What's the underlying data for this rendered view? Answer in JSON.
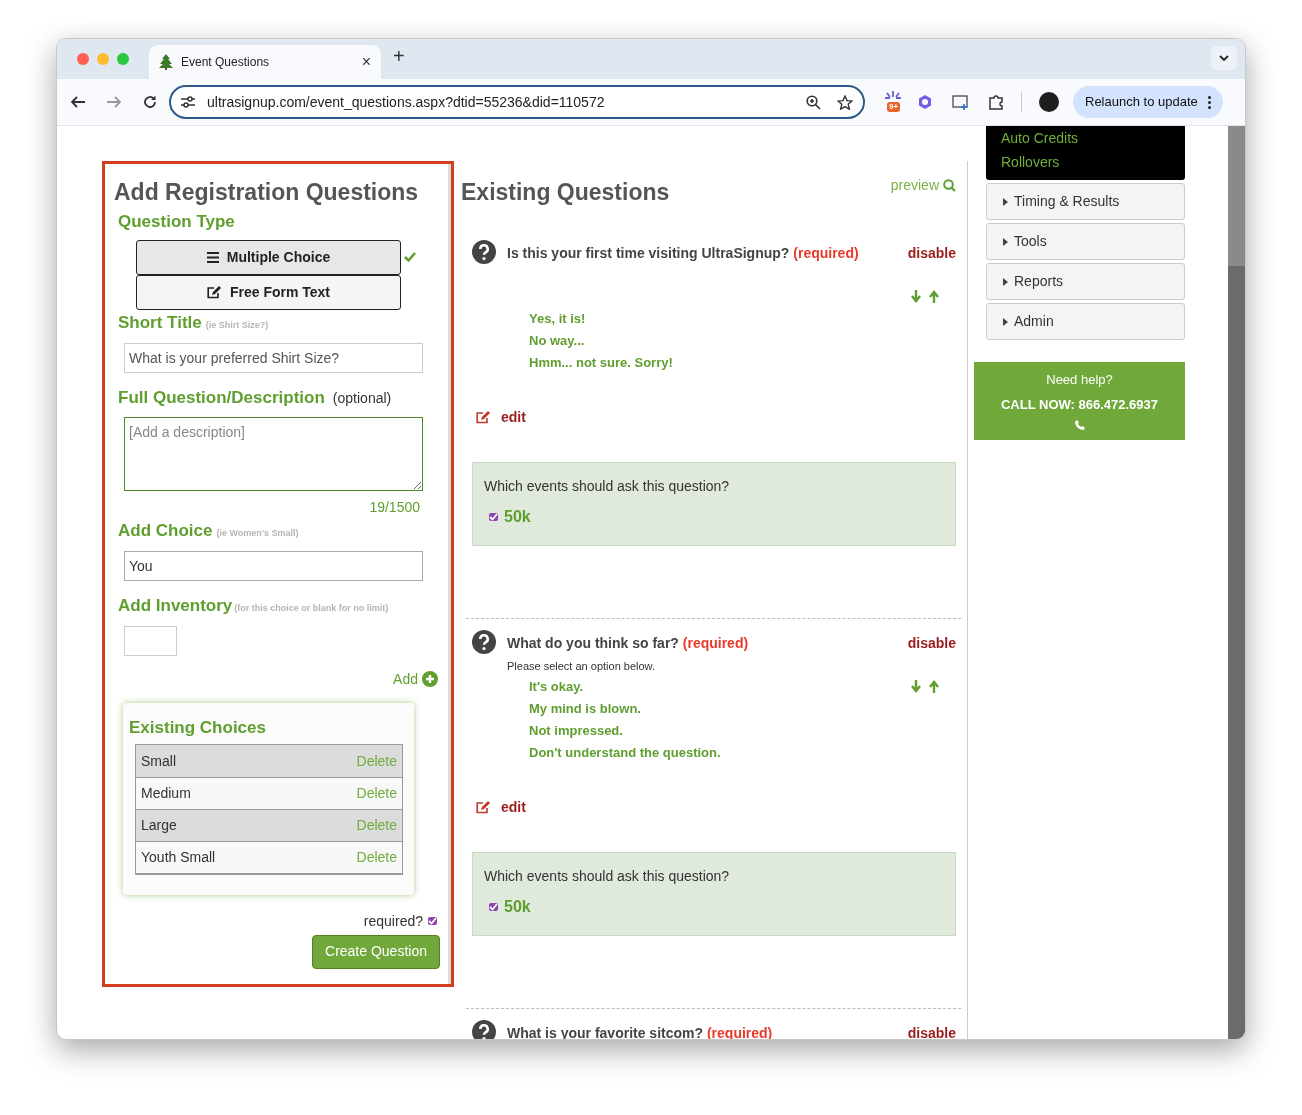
{
  "browser": {
    "tab_title": "Event Questions",
    "tab_close": "×",
    "new_tab": "+",
    "url": "ultrasignup.com/event_questions.aspx?dtid=55236&did=110572",
    "extension_badge": "9+",
    "relaunch_button": "Relaunch to update"
  },
  "add_panel": {
    "title": "Add Registration Questions",
    "question_type_label": "Question Type",
    "type_buttons": [
      {
        "label": "Multiple Choice",
        "kind": "list",
        "selected": true
      },
      {
        "label": "Free Form Text",
        "kind": "edit",
        "selected": false
      }
    ],
    "short_title": {
      "label": "Short Title",
      "hint": "(ie Shirt Size?)",
      "value": "What is your preferred Shirt Size?"
    },
    "description": {
      "label": "Full Question/Description",
      "optional": "(optional)",
      "placeholder": "[Add a description]",
      "counter": "19/1500"
    },
    "choice": {
      "label": "Add Choice",
      "hint": "(ie Women's Small)",
      "value": "You"
    },
    "inventory": {
      "label": "Add Inventory",
      "hint": "(for this choice or blank for no limit)"
    },
    "add_link": "Add",
    "existing_choices": {
      "title": "Existing Choices",
      "rows": [
        {
          "name": "Small",
          "action": "Delete"
        },
        {
          "name": "Medium",
          "action": "Delete"
        },
        {
          "name": "Large",
          "action": "Delete"
        },
        {
          "name": "Youth Small",
          "action": "Delete"
        }
      ]
    },
    "required": {
      "label": "required?",
      "checked": true
    },
    "create_button": "Create Question"
  },
  "existing": {
    "title": "Existing Questions",
    "preview_link": "preview",
    "questions": [
      {
        "text": "Is this your first time visiting UltraSignup?",
        "required_tag": "(required)",
        "disable": "disable",
        "choices": [
          "Yes, it is!",
          "No way...",
          "Hmm... not sure. Sorry!"
        ],
        "edit": "edit",
        "events_prompt": "Which events should ask this question?",
        "events": [
          {
            "label": "50k",
            "checked": true
          }
        ]
      },
      {
        "text": "What do you think so far?",
        "required_tag": "(required)",
        "disable": "disable",
        "description": "Please select an option below.",
        "choices": [
          "It's okay.",
          "My mind is blown.",
          "Not impressed.",
          "Don't understand the question."
        ],
        "edit": "edit",
        "events_prompt": "Which events should ask this question?",
        "events": [
          {
            "label": "50k",
            "checked": true
          }
        ]
      },
      {
        "text": "What is your favorite sitcom?",
        "required_tag": "(required)",
        "disable": "disable"
      }
    ]
  },
  "sidebar": {
    "menu_links": [
      "Auto Credits",
      "Rollovers"
    ],
    "sections": [
      "Timing & Results",
      "Tools",
      "Reports",
      "Admin"
    ],
    "help": {
      "line1": "Need help?",
      "line2": "CALL NOW: 866.472.6937"
    }
  }
}
